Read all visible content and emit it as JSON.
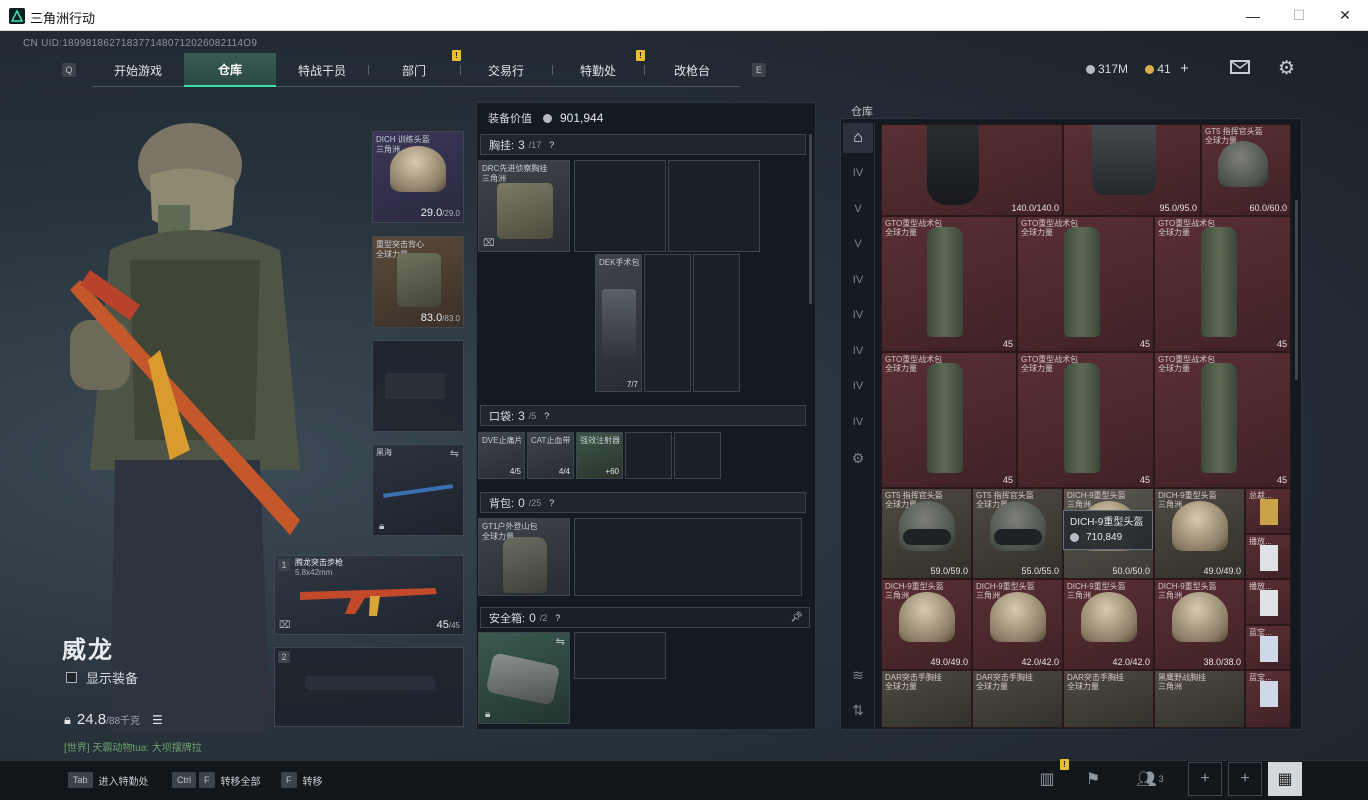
{
  "window": {
    "title": "三角洲行动",
    "minimize": "—",
    "maximize": "☐",
    "close": "✕"
  },
  "uid": "CN UID:1899818627183771480712026082114O9",
  "nav": {
    "left_key": "Q",
    "right_key": "E",
    "tabs": [
      {
        "label": "开始游戏"
      },
      {
        "label": "仓库"
      },
      {
        "label": "特战干员"
      },
      {
        "label": "部门"
      },
      {
        "label": "交易行"
      },
      {
        "label": "特勤处"
      },
      {
        "label": "改枪台"
      }
    ],
    "alert": "!"
  },
  "currency": {
    "silver": "317M",
    "gold": "41",
    "add": "+"
  },
  "character": {
    "name": "威龙",
    "show_gear_label": "显示装备",
    "weight": "24.8",
    "weight_max": "/88千克",
    "chat": "[世界] 天霸动物tua: 大坝摆牌拉"
  },
  "equip": {
    "helmet": {
      "name": "DICH 训练头盔\n三角洲",
      "dur": "29.0",
      "dur_max": "/29.0"
    },
    "armor": {
      "name": "重型突击背心\n全球力量",
      "dur": "83.0",
      "dur_max": "/83.0"
    },
    "melee": {
      "name": "黑海"
    },
    "primary": {
      "slot": "1",
      "name": "腾龙突击步枪",
      "caliber": "5.8x42mm",
      "ammo": "45",
      "ammo_max": "/45"
    },
    "secondary": {
      "slot": "2"
    }
  },
  "middle": {
    "value_label": "装备价值",
    "value": "901,944",
    "chest": {
      "label": "胸挂:",
      "count": "3",
      "max": "/17",
      "item": "DRC先进侦察胸挂\n三角洲"
    },
    "pouch_item": {
      "name": "DEK手术包",
      "count": "7/7"
    },
    "pocket": {
      "label": "口袋:",
      "count": "3",
      "max": "/5",
      "items": [
        {
          "name": "DVE止痛片",
          "count": "4/5"
        },
        {
          "name": "CAT止血带",
          "count": "4/4"
        },
        {
          "name": "强效注射器",
          "count": "+60"
        }
      ]
    },
    "backpack": {
      "label": "背包:",
      "count": "0",
      "max": "/25",
      "item": "GT1户外登山包\n全球力量"
    },
    "safebox": {
      "label": "安全箱:",
      "count": "0",
      "max": "/2"
    },
    "help": "?"
  },
  "warehouse": {
    "label": "仓库",
    "top_row": [
      {
        "name": "",
        "count": "140.0/140.0"
      },
      {
        "name": "",
        "count": "95.0/95.0"
      },
      {
        "name": "GT5 指挥官头盔\n全球力量",
        "count": "60.0/60.0"
      }
    ],
    "bags": [
      {
        "name": "GTO重型战术包\n全球力量",
        "count": "45"
      },
      {
        "name": "GTO重型战术包\n全球力量",
        "count": "45"
      },
      {
        "name": "GTO重型战术包\n全球力量",
        "count": "45"
      },
      {
        "name": "GTO重型战术包\n全球力量",
        "count": "45"
      },
      {
        "name": "GTO重型战术包\n全球力量",
        "count": "45"
      },
      {
        "name": "GTO重型战术包\n全球力量",
        "count": "45"
      }
    ],
    "helmets_row1": [
      {
        "name": "GT5 指挥官头盔\n全球力量",
        "count": "59.0/59.0"
      },
      {
        "name": "GT5 指挥官头盔\n全球力量",
        "count": "55.0/55.0"
      },
      {
        "name": "DICH-9重型头盔\n三角洲",
        "count": "50.0/50.0"
      },
      {
        "name": "DICH-9重型头盔\n三角洲",
        "count": "49.0/49.0"
      }
    ],
    "helmets_row2": [
      {
        "name": "DICH-9重型头盔\n三角洲",
        "count": "49.0/49.0"
      },
      {
        "name": "DICH-9重型头盔\n三角洲",
        "count": "42.0/42.0"
      },
      {
        "name": "DICH-9重型头盔\n三角洲",
        "count": "42.0/42.0"
      },
      {
        "name": "DICH-9重型头盔\n三角洲",
        "count": "38.0/38.0"
      }
    ],
    "rigs": [
      {
        "name": "DAR突击手胸挂\n全球力量"
      },
      {
        "name": "DAR突击手胸挂\n全球力量"
      },
      {
        "name": "DAR突击手胸挂\n全球力量"
      },
      {
        "name": "黑鹰野战胸挂\n三角洲"
      }
    ],
    "side_items": [
      {
        "name": "总裁..."
      },
      {
        "name": "播放..."
      },
      {
        "name": "播放..."
      },
      {
        "name": "蓝宝..."
      },
      {
        "name": "蓝宝..."
      }
    ],
    "tooltip": {
      "name": "DICH-9重型头盔",
      "price": "710,849"
    },
    "tab_labels": [
      "IV",
      "V",
      "V",
      "IV",
      "IV",
      "IV",
      "IV",
      "IV"
    ]
  },
  "bottom": {
    "actions": [
      {
        "key": "Tab",
        "label": "进入特勤处"
      },
      {
        "key": "Ctrl",
        "key2": "F",
        "label": "转移全部"
      },
      {
        "key": "F",
        "label": "转移"
      }
    ],
    "squad_count": "3"
  },
  "colors": {
    "accent": "#3ee1a8",
    "warn": "#e8c02b",
    "inv_red": "#5a2f33"
  }
}
